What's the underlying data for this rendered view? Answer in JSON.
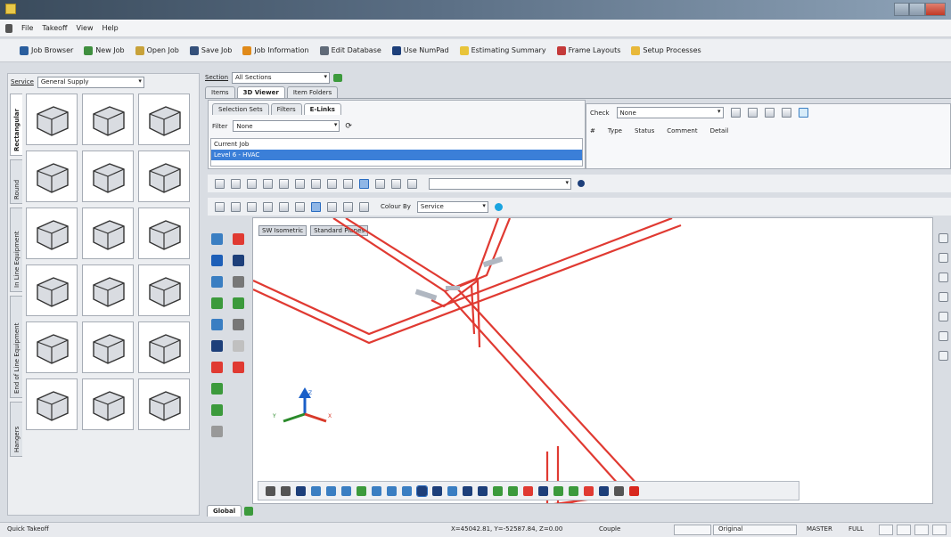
{
  "menu": [
    "File",
    "Takeoff",
    "View",
    "Help"
  ],
  "main_toolbar": [
    {
      "label": "Job Browser",
      "icon": "job-browser-icon",
      "color": "#2a5e9e"
    },
    {
      "label": "New Job",
      "icon": "new-job-icon",
      "color": "#3f8f3f"
    },
    {
      "label": "Open Job",
      "icon": "open-job-icon",
      "color": "#c8a23a"
    },
    {
      "label": "Save Job",
      "icon": "save-job-icon",
      "color": "#34507a"
    },
    {
      "label": "Job Information",
      "icon": "info-icon",
      "color": "#e08a1a"
    },
    {
      "label": "Edit Database",
      "icon": "database-icon",
      "color": "#606a78"
    },
    {
      "label": "Use NumPad",
      "icon": "numpad-icon",
      "color": "#1d3f7a"
    },
    {
      "label": "Estimating Summary",
      "icon": "summary-icon",
      "color": "#e8c43a"
    },
    {
      "label": "Frame Layouts",
      "icon": "frame-layouts-icon",
      "color": "#c43a3a"
    },
    {
      "label": "Setup Processes",
      "icon": "setup-icon",
      "color": "#e8b83a"
    }
  ],
  "service": {
    "label": "Service",
    "value": "General Supply"
  },
  "vertical_tabs": [
    "Rectangular",
    "Round",
    "In Line Equipment",
    "End of Line Equipment",
    "Hangers"
  ],
  "section": {
    "label": "Section",
    "value": "All Sections"
  },
  "view_tabs": [
    "Items",
    "3D Viewer",
    "Item Folders"
  ],
  "selection_tabs": [
    "Selection Sets",
    "Filters",
    "E-Links"
  ],
  "filter": {
    "label": "Filter",
    "value": "None"
  },
  "job_list": [
    "Current Job",
    "Level 6 - HVAC"
  ],
  "check": {
    "label": "Check",
    "value": "None",
    "columns": [
      "#",
      "Type",
      "Status",
      "Comment",
      "Detail"
    ]
  },
  "colour_by": {
    "label": "Colour By",
    "value": "Service"
  },
  "viewport_labels": [
    "SW Isometric",
    "Standard Planes"
  ],
  "axis": {
    "z": "Z",
    "y": "Y",
    "x": "X"
  },
  "global_tab": "Global",
  "status": {
    "left": "Quick Takeoff",
    "coords": "X=45042.81, Y=-52587.84, Z=0.00",
    "couple": "Couple",
    "original": "Original",
    "master": "MASTER",
    "full": "FULL"
  },
  "colors": {
    "duct": "#e03a32",
    "selected": "#3b7fd8"
  }
}
